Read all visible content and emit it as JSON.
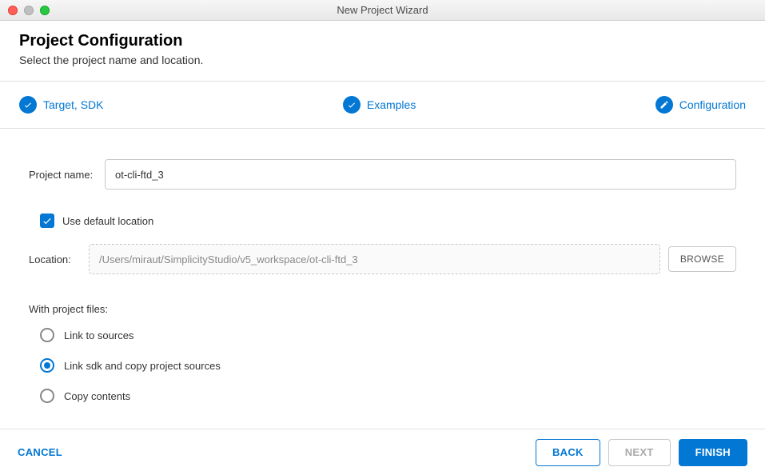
{
  "window": {
    "title": "New Project Wizard"
  },
  "header": {
    "title": "Project Configuration",
    "subtitle": "Select the project name and location."
  },
  "stepper": {
    "step1": "Target, SDK",
    "step2": "Examples",
    "step3": "Configuration"
  },
  "form": {
    "project_name_label": "Project name:",
    "project_name_value": "ot-cli-ftd_3",
    "use_default_location_label": "Use default location",
    "location_label": "Location:",
    "location_value": "/Users/miraut/SimplicityStudio/v5_workspace/ot-cli-ftd_3",
    "browse_label": "BROWSE",
    "with_files_label": "With project files:",
    "radio_link_sources": "Link to sources",
    "radio_link_sdk_copy": "Link sdk and copy project sources",
    "radio_copy_contents": "Copy contents"
  },
  "footer": {
    "cancel": "CANCEL",
    "back": "BACK",
    "next": "NEXT",
    "finish": "FINISH"
  }
}
